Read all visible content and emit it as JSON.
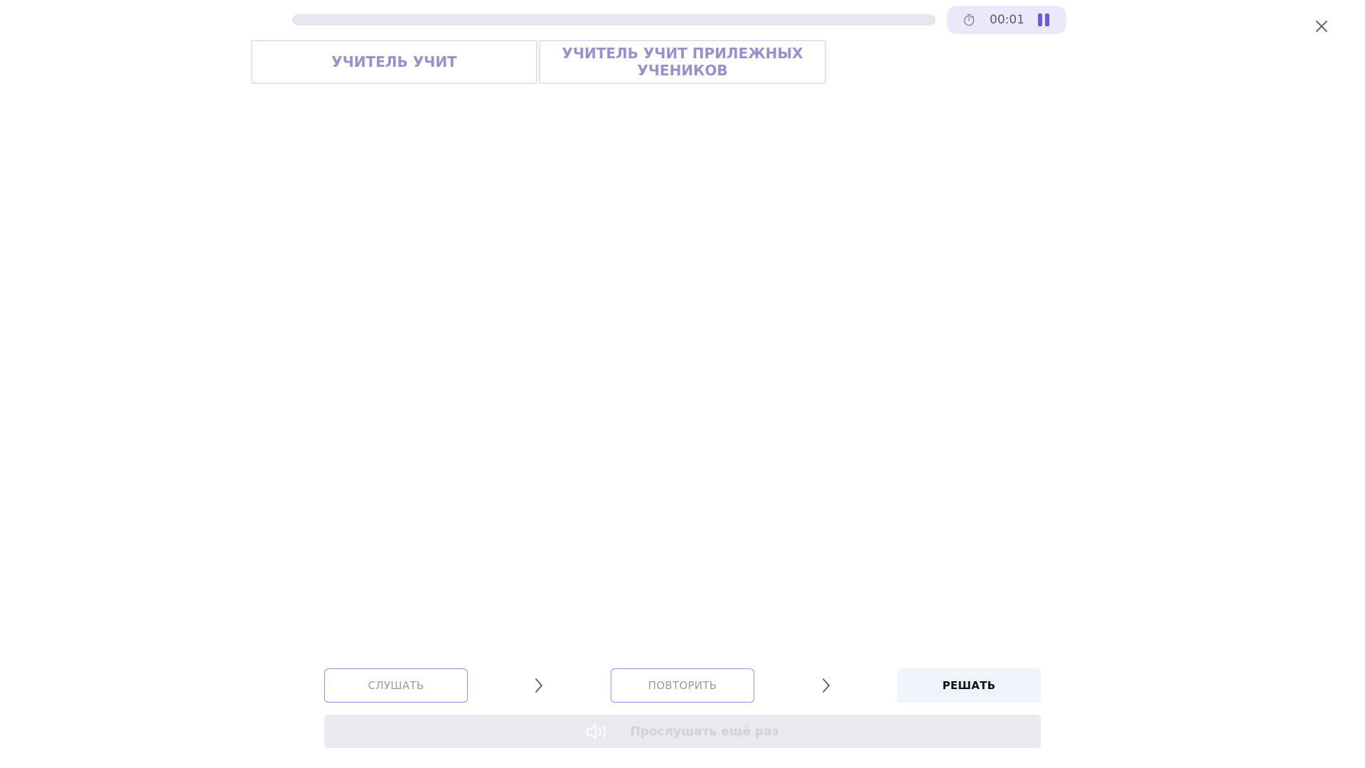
{
  "progress": {
    "fraction": 0.0
  },
  "timer": {
    "icon": "stopwatch-icon",
    "time": "00:01",
    "pause_icon": "pause-icon"
  },
  "close": {
    "icon": "close-icon"
  },
  "word_cards": [
    {
      "text": "УЧИТЕЛЬ УЧИТ"
    },
    {
      "text": "УЧИТЕЛЬ УЧИТ ПРИЛЕЖНЫХ УЧЕНИКОВ"
    }
  ],
  "steps": {
    "listen_label": "СЛУШАТЬ",
    "repeat_label": "ПОВТОРИТЬ",
    "solve_label": "РЕШАТЬ",
    "separator_icon": "chevron-right-icon"
  },
  "listen_again": {
    "icon": "speaker-icon",
    "label": "Прослушать ещё раз"
  },
  "colors": {
    "accent": "#6b5bd8",
    "card_text": "#9a8fd0",
    "timer_bg": "#ebe8fb",
    "solve_bg": "#eef3fc",
    "listen_again_bg": "#e8eaef"
  }
}
